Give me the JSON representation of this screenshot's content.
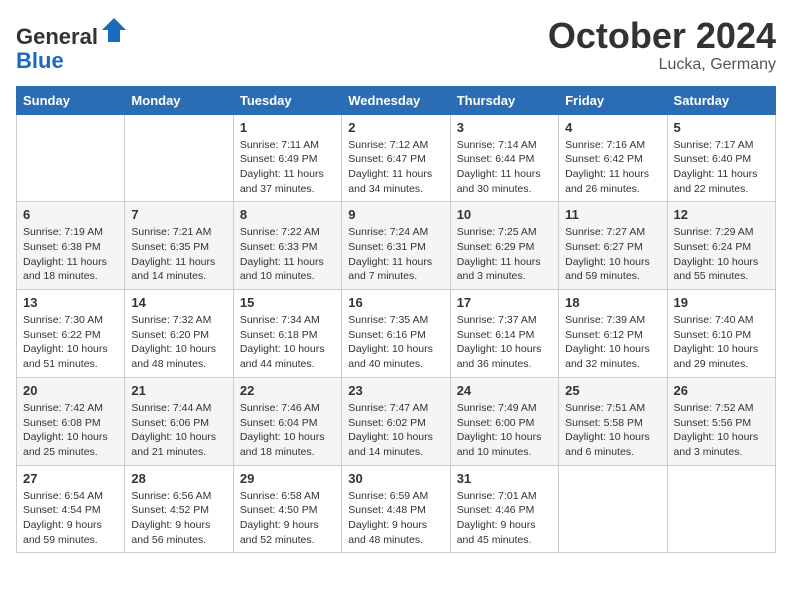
{
  "header": {
    "logo_line1": "General",
    "logo_line2": "Blue",
    "month_title": "October 2024",
    "location": "Lucka, Germany"
  },
  "weekdays": [
    "Sunday",
    "Monday",
    "Tuesday",
    "Wednesday",
    "Thursday",
    "Friday",
    "Saturday"
  ],
  "weeks": [
    [
      {
        "day": "",
        "detail": ""
      },
      {
        "day": "",
        "detail": ""
      },
      {
        "day": "1",
        "detail": "Sunrise: 7:11 AM\nSunset: 6:49 PM\nDaylight: 11 hours\nand 37 minutes."
      },
      {
        "day": "2",
        "detail": "Sunrise: 7:12 AM\nSunset: 6:47 PM\nDaylight: 11 hours\nand 34 minutes."
      },
      {
        "day": "3",
        "detail": "Sunrise: 7:14 AM\nSunset: 6:44 PM\nDaylight: 11 hours\nand 30 minutes."
      },
      {
        "day": "4",
        "detail": "Sunrise: 7:16 AM\nSunset: 6:42 PM\nDaylight: 11 hours\nand 26 minutes."
      },
      {
        "day": "5",
        "detail": "Sunrise: 7:17 AM\nSunset: 6:40 PM\nDaylight: 11 hours\nand 22 minutes."
      }
    ],
    [
      {
        "day": "6",
        "detail": "Sunrise: 7:19 AM\nSunset: 6:38 PM\nDaylight: 11 hours\nand 18 minutes."
      },
      {
        "day": "7",
        "detail": "Sunrise: 7:21 AM\nSunset: 6:35 PM\nDaylight: 11 hours\nand 14 minutes."
      },
      {
        "day": "8",
        "detail": "Sunrise: 7:22 AM\nSunset: 6:33 PM\nDaylight: 11 hours\nand 10 minutes."
      },
      {
        "day": "9",
        "detail": "Sunrise: 7:24 AM\nSunset: 6:31 PM\nDaylight: 11 hours\nand 7 minutes."
      },
      {
        "day": "10",
        "detail": "Sunrise: 7:25 AM\nSunset: 6:29 PM\nDaylight: 11 hours\nand 3 minutes."
      },
      {
        "day": "11",
        "detail": "Sunrise: 7:27 AM\nSunset: 6:27 PM\nDaylight: 10 hours\nand 59 minutes."
      },
      {
        "day": "12",
        "detail": "Sunrise: 7:29 AM\nSunset: 6:24 PM\nDaylight: 10 hours\nand 55 minutes."
      }
    ],
    [
      {
        "day": "13",
        "detail": "Sunrise: 7:30 AM\nSunset: 6:22 PM\nDaylight: 10 hours\nand 51 minutes."
      },
      {
        "day": "14",
        "detail": "Sunrise: 7:32 AM\nSunset: 6:20 PM\nDaylight: 10 hours\nand 48 minutes."
      },
      {
        "day": "15",
        "detail": "Sunrise: 7:34 AM\nSunset: 6:18 PM\nDaylight: 10 hours\nand 44 minutes."
      },
      {
        "day": "16",
        "detail": "Sunrise: 7:35 AM\nSunset: 6:16 PM\nDaylight: 10 hours\nand 40 minutes."
      },
      {
        "day": "17",
        "detail": "Sunrise: 7:37 AM\nSunset: 6:14 PM\nDaylight: 10 hours\nand 36 minutes."
      },
      {
        "day": "18",
        "detail": "Sunrise: 7:39 AM\nSunset: 6:12 PM\nDaylight: 10 hours\nand 32 minutes."
      },
      {
        "day": "19",
        "detail": "Sunrise: 7:40 AM\nSunset: 6:10 PM\nDaylight: 10 hours\nand 29 minutes."
      }
    ],
    [
      {
        "day": "20",
        "detail": "Sunrise: 7:42 AM\nSunset: 6:08 PM\nDaylight: 10 hours\nand 25 minutes."
      },
      {
        "day": "21",
        "detail": "Sunrise: 7:44 AM\nSunset: 6:06 PM\nDaylight: 10 hours\nand 21 minutes."
      },
      {
        "day": "22",
        "detail": "Sunrise: 7:46 AM\nSunset: 6:04 PM\nDaylight: 10 hours\nand 18 minutes."
      },
      {
        "day": "23",
        "detail": "Sunrise: 7:47 AM\nSunset: 6:02 PM\nDaylight: 10 hours\nand 14 minutes."
      },
      {
        "day": "24",
        "detail": "Sunrise: 7:49 AM\nSunset: 6:00 PM\nDaylight: 10 hours\nand 10 minutes."
      },
      {
        "day": "25",
        "detail": "Sunrise: 7:51 AM\nSunset: 5:58 PM\nDaylight: 10 hours\nand 6 minutes."
      },
      {
        "day": "26",
        "detail": "Sunrise: 7:52 AM\nSunset: 5:56 PM\nDaylight: 10 hours\nand 3 minutes."
      }
    ],
    [
      {
        "day": "27",
        "detail": "Sunrise: 6:54 AM\nSunset: 4:54 PM\nDaylight: 9 hours\nand 59 minutes."
      },
      {
        "day": "28",
        "detail": "Sunrise: 6:56 AM\nSunset: 4:52 PM\nDaylight: 9 hours\nand 56 minutes."
      },
      {
        "day": "29",
        "detail": "Sunrise: 6:58 AM\nSunset: 4:50 PM\nDaylight: 9 hours\nand 52 minutes."
      },
      {
        "day": "30",
        "detail": "Sunrise: 6:59 AM\nSunset: 4:48 PM\nDaylight: 9 hours\nand 48 minutes."
      },
      {
        "day": "31",
        "detail": "Sunrise: 7:01 AM\nSunset: 4:46 PM\nDaylight: 9 hours\nand 45 minutes."
      },
      {
        "day": "",
        "detail": ""
      },
      {
        "day": "",
        "detail": ""
      }
    ]
  ]
}
